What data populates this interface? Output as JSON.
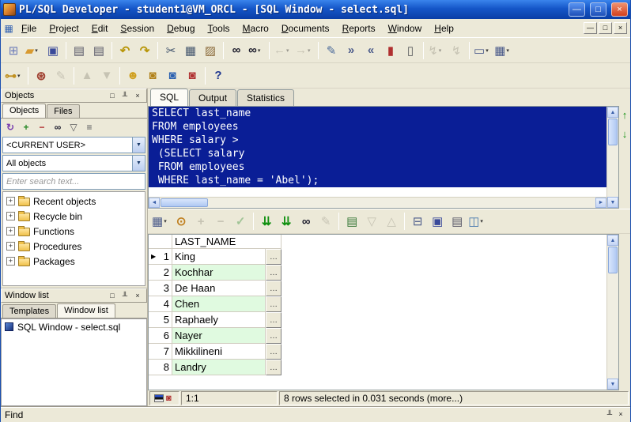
{
  "window": {
    "title": "PL/SQL Developer - student1@VM_ORCL - [SQL Window - select.sql]"
  },
  "menu": {
    "items": [
      "File",
      "Project",
      "Edit",
      "Session",
      "Debug",
      "Tools",
      "Macro",
      "Documents",
      "Reports",
      "Window",
      "Help"
    ]
  },
  "toolbar_main": [
    {
      "name": "new-button",
      "glyph": "⊞",
      "color": "#6A7AB8"
    },
    {
      "name": "open-button",
      "glyph": "▰",
      "color": "#D89A30",
      "dropdown": true
    },
    {
      "name": "save-button",
      "glyph": "▣",
      "color": "#3A4A9A"
    },
    {
      "sep": true
    },
    {
      "name": "print-button",
      "glyph": "▤",
      "color": "#5A5A6A"
    },
    {
      "name": "print-selection-button",
      "glyph": "▤",
      "color": "#5A5A6A"
    },
    {
      "sep": true
    },
    {
      "name": "undo-button",
      "glyph": "↶",
      "color": "#B8960A",
      "bold": true
    },
    {
      "name": "redo-button",
      "glyph": "↷",
      "color": "#B8960A",
      "bold": true
    },
    {
      "sep": true
    },
    {
      "name": "cut-button",
      "glyph": "✂",
      "color": "#44566E"
    },
    {
      "name": "copy-button",
      "glyph": "▦",
      "color": "#44566E"
    },
    {
      "name": "paste-button",
      "glyph": "▨",
      "color": "#8A6A3A"
    },
    {
      "sep": true
    },
    {
      "name": "find-button",
      "glyph": "∞",
      "color": "#1A1A2A",
      "bold": true
    },
    {
      "name": "find-next-button",
      "glyph": "∞",
      "color": "#1A1A2A",
      "bold": true,
      "dropdown": true
    },
    {
      "sep": true
    },
    {
      "name": "back-button",
      "glyph": "←",
      "color": "#9A9688",
      "disabled": true,
      "dropdown": true
    },
    {
      "name": "forward-button",
      "glyph": "→",
      "color": "#9A9688",
      "disabled": true,
      "dropdown": true
    },
    {
      "sep": true
    },
    {
      "name": "edit-with-button",
      "glyph": "✎",
      "color": "#4A6A9A"
    },
    {
      "name": "indent-button",
      "glyph": "»",
      "color": "#4A5A8A",
      "bold": true
    },
    {
      "name": "outdent-button",
      "glyph": "«",
      "color": "#4A5A8A",
      "bold": true
    },
    {
      "name": "syntax-reference-button",
      "glyph": "▮",
      "color": "#B03030"
    },
    {
      "name": "describe-button",
      "glyph": "▯",
      "color": "#55565A"
    },
    {
      "sep": true
    },
    {
      "name": "macro-button",
      "glyph": "↯",
      "color": "#9A9688",
      "disabled": true,
      "dropdown": true
    },
    {
      "name": "macro-run-button",
      "glyph": "↯",
      "color": "#9A9688",
      "disabled": true
    },
    {
      "sep": true
    },
    {
      "name": "window-button",
      "glyph": "▭",
      "color": "#4A5A8A",
      "dropdown": true
    },
    {
      "name": "window-layout-button",
      "glyph": "▦",
      "color": "#4A5A8A",
      "dropdown": true
    }
  ],
  "toolbar_secondary": [
    {
      "name": "logon-button",
      "glyph": "⊶",
      "color": "#C09020",
      "bold": true,
      "dropdown": true
    },
    {
      "sep": true
    },
    {
      "name": "configure-tools-button",
      "glyph": "⊛",
      "color": "#A04030",
      "bold": true
    },
    {
      "name": "beautify-button",
      "glyph": "✎",
      "color": "#9A9688",
      "disabled": true
    },
    {
      "sep": true
    },
    {
      "name": "load-layout-button",
      "glyph": "▲",
      "color": "#9A9688",
      "disabled": true
    },
    {
      "name": "save-layout-button",
      "glyph": "▼",
      "color": "#9A9688",
      "disabled": true
    },
    {
      "sep": true
    },
    {
      "name": "new-session-button",
      "glyph": "☻",
      "color": "#D0A020"
    },
    {
      "name": "new-sql-window-button",
      "glyph": "◙",
      "color": "#B08018"
    },
    {
      "name": "new-command-window-button",
      "glyph": "◙",
      "color": "#2A60B0"
    },
    {
      "name": "new-report-window-button",
      "glyph": "◙",
      "color": "#B03030"
    },
    {
      "sep": true
    },
    {
      "name": "help-button",
      "glyph": "?",
      "color": "#203890",
      "bold": true
    }
  ],
  "objects_panel": {
    "title": "Objects",
    "tabs": [
      "Objects",
      "Files"
    ],
    "active_tab": "Objects",
    "toolbar": [
      {
        "name": "refresh-icon",
        "glyph": "↻",
        "color": "#7A40B0",
        "bold": true
      },
      {
        "name": "add-folder-icon",
        "glyph": "+",
        "color": "#2A8A2A",
        "bold": true
      },
      {
        "name": "remove-folder-icon",
        "glyph": "−",
        "color": "#B03030",
        "bold": true
      },
      {
        "name": "find-object-icon",
        "glyph": "∞",
        "color": "#1A1A2A",
        "bold": true
      },
      {
        "name": "filter-icon",
        "glyph": "▽",
        "color": "#55565A"
      },
      {
        "name": "list-options-icon",
        "glyph": "≡",
        "color": "#55565A"
      }
    ],
    "user_dropdown": "<CURRENT USER>",
    "filter_dropdown": "All objects",
    "search_placeholder": "Enter search text...",
    "tree_items": [
      "Recent objects",
      "Recycle bin",
      "Functions",
      "Procedures",
      "Packages"
    ]
  },
  "window_list_panel": {
    "title": "Window list",
    "tabs": [
      "Templates",
      "Window list"
    ],
    "active_tab": "Window list",
    "items": [
      "SQL Window - select.sql"
    ]
  },
  "editor": {
    "tabs": [
      "SQL",
      "Output",
      "Statistics"
    ],
    "active_tab": "SQL",
    "sql_lines": [
      "SELECT last_name",
      "FROM employees",
      "WHERE salary >",
      " (SELECT salary",
      " FROM employees",
      " WHERE last_name = 'Abel');"
    ]
  },
  "results_toolbar": [
    {
      "name": "grid-options-button",
      "glyph": "▦",
      "color": "#4A5A8A",
      "dropdown": true
    },
    {
      "name": "lock-button",
      "glyph": "⊙",
      "color": "#C08020",
      "bold": true
    },
    {
      "name": "insert-record-button",
      "glyph": "+",
      "color": "#9A9688",
      "bold": true,
      "disabled": true
    },
    {
      "name": "delete-record-button",
      "glyph": "−",
      "color": "#9A9688",
      "bold": true,
      "disabled": true
    },
    {
      "name": "post-changes-button",
      "glyph": "✓",
      "color": "#4A9A4A",
      "bold": true,
      "disabled": true
    },
    {
      "sep": true
    },
    {
      "name": "fetch-next-page-button",
      "glyph": "⇊",
      "color": "#109010",
      "bold": true
    },
    {
      "name": "fetch-all-button",
      "glyph": "⇊",
      "color": "#109010",
      "bold": true
    },
    {
      "name": "find-data-button",
      "glyph": "∞",
      "color": "#1A1A2A",
      "bold": true
    },
    {
      "name": "edit-popup-button",
      "glyph": "✎",
      "color": "#9A9688",
      "disabled": true
    },
    {
      "sep": true
    },
    {
      "name": "export-data-button",
      "glyph": "▤",
      "color": "#3A7A3A"
    },
    {
      "name": "previous-record-button",
      "glyph": "▽",
      "color": "#9A9688",
      "disabled": true
    },
    {
      "name": "next-record-button",
      "glyph": "△",
      "color": "#9A9688",
      "disabled": true
    },
    {
      "sep": true
    },
    {
      "name": "single-record-view-button",
      "glyph": "⊟",
      "color": "#4A5A8A"
    },
    {
      "name": "save-results-button",
      "glyph": "▣",
      "color": "#3A4A9A"
    },
    {
      "name": "print-results-button",
      "glyph": "▤",
      "color": "#5A5A6A"
    },
    {
      "name": "chart-button",
      "glyph": "◫",
      "color": "#4A7AB0",
      "dropdown": true
    }
  ],
  "results": {
    "columns": [
      "LAST_NAME"
    ],
    "rows": [
      {
        "num": "1",
        "last_name": "King",
        "current": true
      },
      {
        "num": "2",
        "last_name": "Kochhar"
      },
      {
        "num": "3",
        "last_name": "De Haan"
      },
      {
        "num": "4",
        "last_name": "Chen"
      },
      {
        "num": "5",
        "last_name": "Raphaely"
      },
      {
        "num": "6",
        "last_name": "Nayer"
      },
      {
        "num": "7",
        "last_name": "Mikkilineni"
      },
      {
        "num": "8",
        "last_name": "Landry"
      }
    ]
  },
  "status_bar": {
    "position": "1:1",
    "message": "8 rows selected in 0.031 seconds (more...)"
  },
  "find_bar": {
    "label": "Find"
  },
  "icons": {
    "minimize": "—",
    "restore": "□",
    "close": "×",
    "pin": "╨",
    "float": "□",
    "dropdown": "▼",
    "scroll_up": "▲",
    "scroll_down": "▼",
    "scroll_left": "◄",
    "scroll_right": "►",
    "nav_up": "↑",
    "nav_down": "↓",
    "marker": "▶",
    "expand": "+",
    "dots": "…",
    "sql_window": "▦",
    "window_type": "◙"
  },
  "colors": {
    "titlebar": "#1556C8",
    "editor_selection": "#0A1E96",
    "grid_alt_row": "#E0FAE0"
  }
}
